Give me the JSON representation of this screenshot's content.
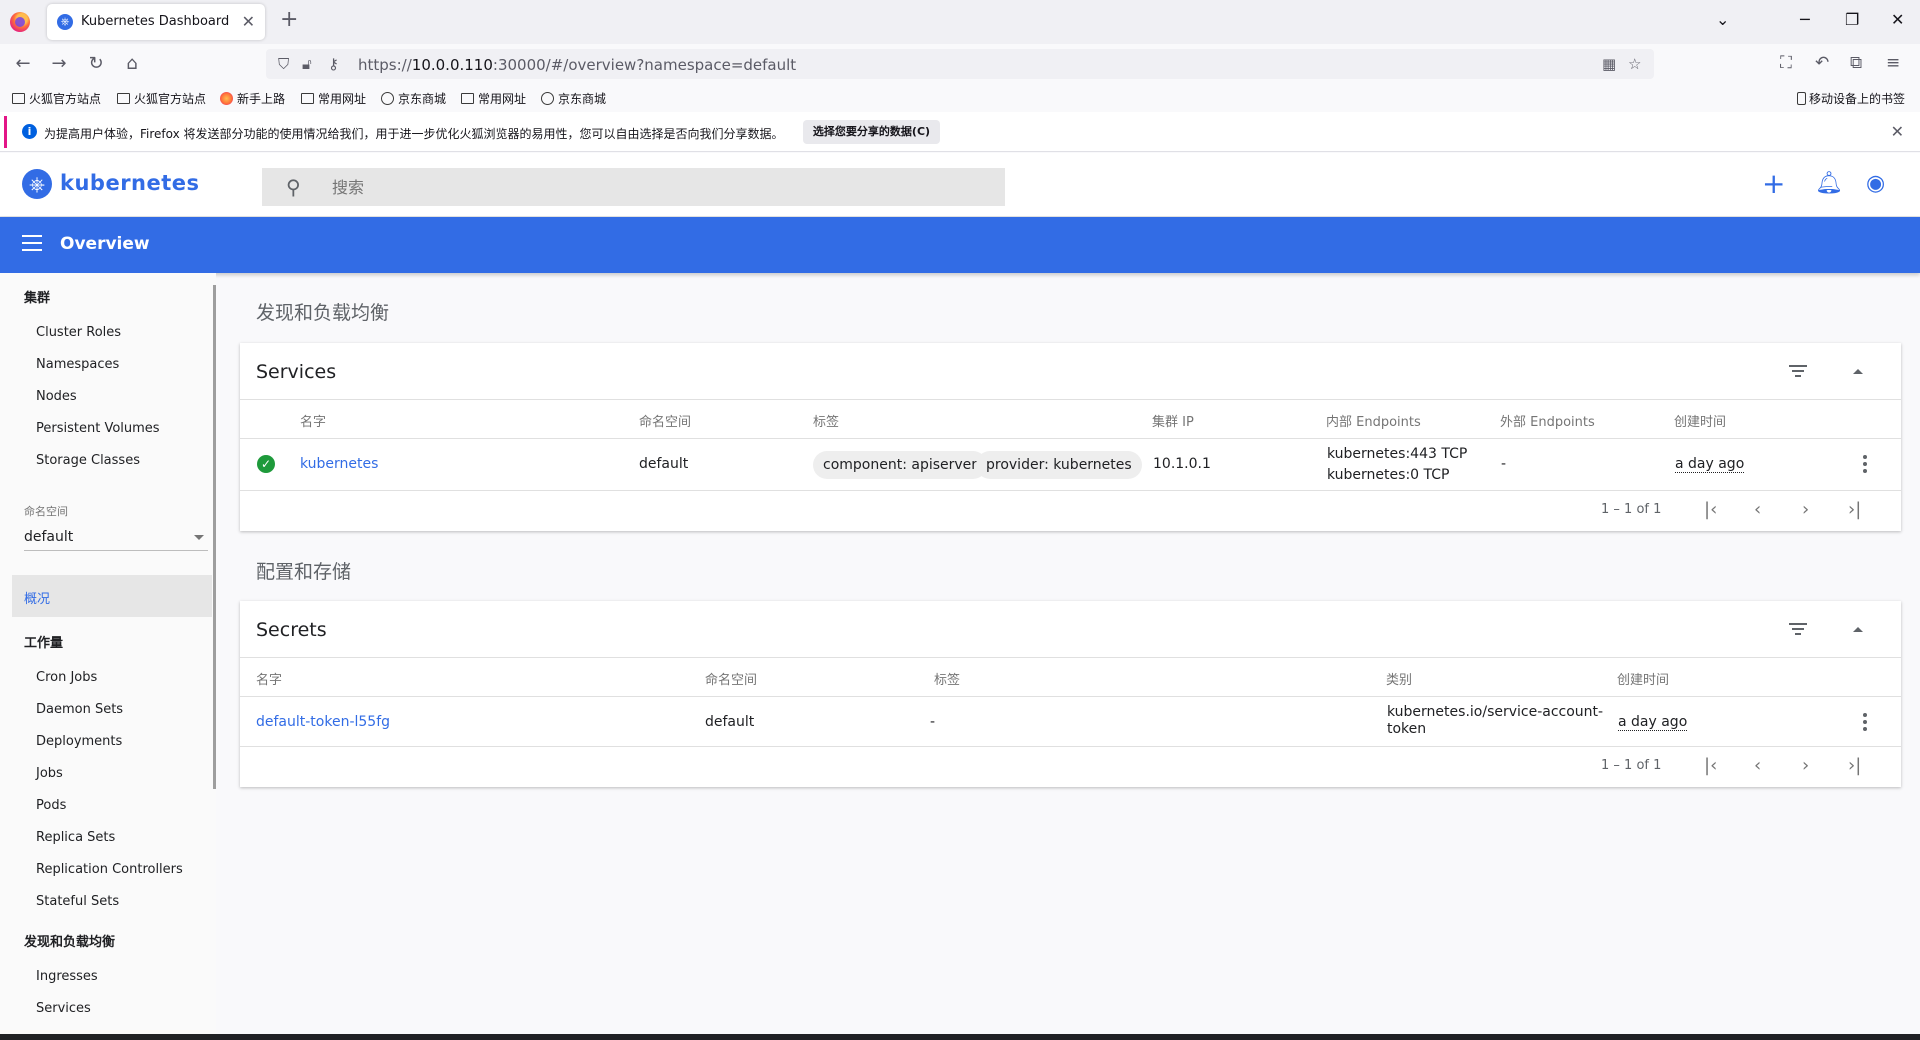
{
  "browser": {
    "tab_title": "Kubernetes Dashboard",
    "url_prefix": "https://",
    "url_host": "10.0.0.110",
    "url_rest": ":30000/#/overview?namespace=default",
    "bookmarks": [
      "火狐官方站点",
      "火狐官方站点",
      "新手上路",
      "常用网址",
      "京东商城",
      "常用网址",
      "京东商城"
    ],
    "mobile_bookmarks": "移动设备上的书签",
    "notice_text": "为提高用户体验，Firefox 将发送部分功能的使用情况给我们，用于进一步优化火狐浏览器的易用性，您可以自由选择是否向我们分享数据。",
    "notice_button": "选择您要分享的数据(C)"
  },
  "app": {
    "brand": "kubernetes",
    "search_placeholder": "搜索",
    "toolbar_title": "Overview"
  },
  "sidebar": {
    "cluster_header": "集群",
    "cluster_items": [
      "Cluster Roles",
      "Namespaces",
      "Nodes",
      "Persistent Volumes",
      "Storage Classes"
    ],
    "namespace_label": "命名空间",
    "namespace_value": "default",
    "overview": "概况",
    "workloads_header": "工作量",
    "workload_items": [
      "Cron Jobs",
      "Daemon Sets",
      "Deployments",
      "Jobs",
      "Pods",
      "Replica Sets",
      "Replication Controllers",
      "Stateful Sets"
    ],
    "discovery_header": "发现和负载均衡",
    "discovery_items": [
      "Ingresses",
      "Services"
    ]
  },
  "main": {
    "section_discovery": "发现和负载均衡",
    "section_config": "配置和存储",
    "services": {
      "title": "Services",
      "headers": [
        "名字",
        "命名空间",
        "标签",
        "集群 IP",
        "内部 Endpoints",
        "外部 Endpoints",
        "创建时间"
      ],
      "row": {
        "name": "kubernetes",
        "namespace": "default",
        "labels": [
          "component: apiserver",
          "provider: kubernetes"
        ],
        "cluster_ip": "10.1.0.1",
        "internal_endpoints": [
          "kubernetes:443 TCP",
          "kubernetes:0 TCP"
        ],
        "external_endpoints": "-",
        "created": "a day ago"
      },
      "pagination": "1 – 1 of 1"
    },
    "secrets": {
      "title": "Secrets",
      "headers": [
        "名字",
        "命名空间",
        "标签",
        "类别",
        "创建时间"
      ],
      "row": {
        "name": "default-token-l55fg",
        "namespace": "default",
        "labels": "-",
        "type_line1": "kubernetes.io/service-account-",
        "type_line2": "token",
        "created": "a day ago"
      },
      "pagination": "1 – 1 of 1"
    }
  }
}
